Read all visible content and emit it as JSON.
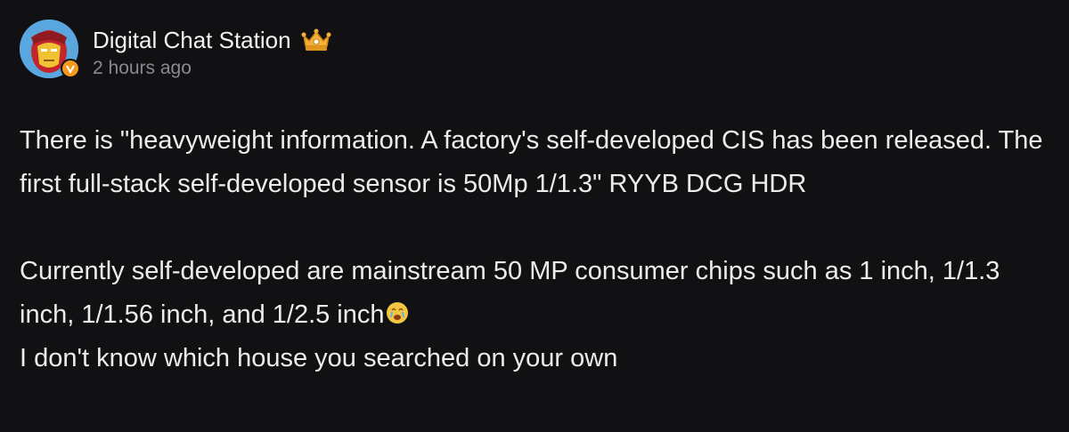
{
  "author": {
    "name": "Digital Chat Station",
    "timestamp": "2 hours ago",
    "avatar_icon": "iron-man-avatar-icon",
    "badge_icon": "verified-v-icon",
    "rank_icon": "crown-icon",
    "badge_color": "#f39a1b"
  },
  "post": {
    "paragraph1": "There is \"heavyweight information. A factory's self-developed CIS has been released. The first full-stack self-developed sensor is 50Mp 1/1.3\" RYYB DCG HDR",
    "paragraph2": "Currently self-developed are mainstream 50 MP consumer chips such as 1 inch, 1/1.3 inch, 1/1.56 inch, and 1/2.5 inch",
    "emoji": "crying-face-emoji",
    "paragraph3": "I don't know which house you searched on your own"
  }
}
